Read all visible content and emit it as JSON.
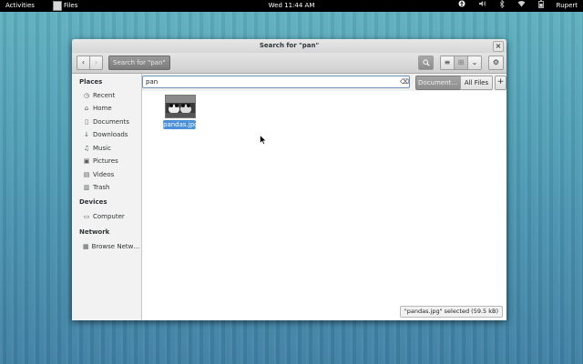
{
  "topbar": {
    "activities": "Activities",
    "app_name": "Files",
    "clock": "Wed 11:44 AM",
    "user": "Rupert",
    "tray_icons": [
      "accessibility-icon",
      "volume-icon",
      "bluetooth-icon",
      "wifi-icon",
      "battery-icon"
    ]
  },
  "window": {
    "title": "Search for \"pan\"",
    "close_symbol": "×"
  },
  "toolbar": {
    "back_symbol": "‹",
    "forward_symbol": "›",
    "path_label": "Search for \"pan\"",
    "search_symbol": "⌕",
    "list_symbol": "≡",
    "grid_symbol": "⊞",
    "view_menu_symbol": "⌄",
    "gear_symbol": "⚙"
  },
  "sidebar": {
    "places_heading": "Places",
    "places": [
      {
        "label": "Recent",
        "icon": "◷"
      },
      {
        "label": "Home",
        "icon": "⌂"
      },
      {
        "label": "Documents",
        "icon": "▯"
      },
      {
        "label": "Downloads",
        "icon": "↓"
      },
      {
        "label": "Music",
        "icon": "♫"
      },
      {
        "label": "Pictures",
        "icon": "▣"
      },
      {
        "label": "Videos",
        "icon": "▤"
      },
      {
        "label": "Trash",
        "icon": "▥"
      }
    ],
    "devices_heading": "Devices",
    "devices": [
      {
        "label": "Computer",
        "icon": "▭"
      }
    ],
    "network_heading": "Network",
    "network": [
      {
        "label": "Browse Netw…",
        "icon": "▦"
      }
    ]
  },
  "search": {
    "query": "pan",
    "clear_symbol": "⌫",
    "filter_type": "Document…",
    "filter_location": "All Files",
    "add_symbol": "+"
  },
  "results": [
    {
      "name": "pandas.jpg",
      "selected": true
    }
  ],
  "status": {
    "text": "\"pandas.jpg\" selected (59.5 kB)"
  },
  "colors": {
    "selection": "#4a90d9",
    "topbar": "#000000",
    "sidebar": "#f2f2f2"
  }
}
